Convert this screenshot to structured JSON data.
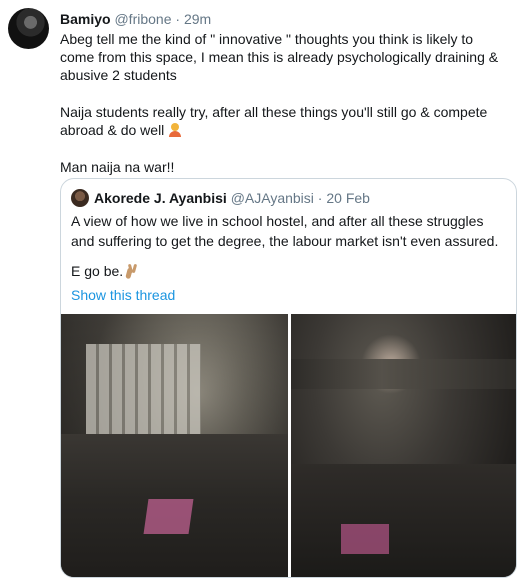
{
  "tweet": {
    "author_name": "Bamiyo",
    "author_handle": "@fribone",
    "separator": "·",
    "time": "29m",
    "paragraph1": "Abeg tell me the kind of \" innovative \" thoughts you think is likely to come from this space, I mean this is already psychologically draining & abusive 2 students",
    "paragraph2": "Naija students really try, after all these things you'll still go & compete abroad & do well",
    "paragraph2_emoji": "person-gesturing-emoji",
    "paragraph3": "Man naija na war!!"
  },
  "quoted": {
    "author_name": "Akorede J. Ayanbisi",
    "author_handle": "@AJAyanbisi",
    "separator": "·",
    "date": "20 Feb",
    "paragraph1": "A view of how we live in school hostel, and after all these struggles and suffering to get the degree, the labour market isn't even assured.",
    "paragraph2": "E go be.",
    "paragraph2_emoji": "victory-hand-emoji",
    "show_thread": "Show this thread"
  },
  "colors": {
    "text": "#14171a",
    "muted": "#657786",
    "link": "#1b95e0",
    "border": "#ccd6dd"
  }
}
